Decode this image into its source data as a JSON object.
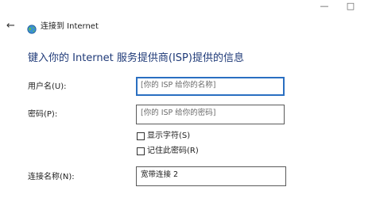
{
  "window": {
    "minimize_glyph": "—",
    "restore_glyph": "□"
  },
  "header": {
    "back_glyph": "←",
    "icon": "network-globe-icon",
    "title": "连接到 Internet"
  },
  "form": {
    "heading": "键入你的 Internet 服务提供商(ISP)提供的信息",
    "username": {
      "label": "用户名(U):",
      "placeholder": "[你的 ISP 给你的名称]"
    },
    "password": {
      "label": "密码(P):",
      "placeholder": "[你的 ISP 给你的密码]"
    },
    "show_chars": {
      "label": "显示字符(S)",
      "checked": false
    },
    "remember_password": {
      "label": "记住此密码(R)",
      "checked": false
    },
    "connection_name": {
      "label": "连接名称(N):",
      "value": "宽带连接 2"
    }
  }
}
